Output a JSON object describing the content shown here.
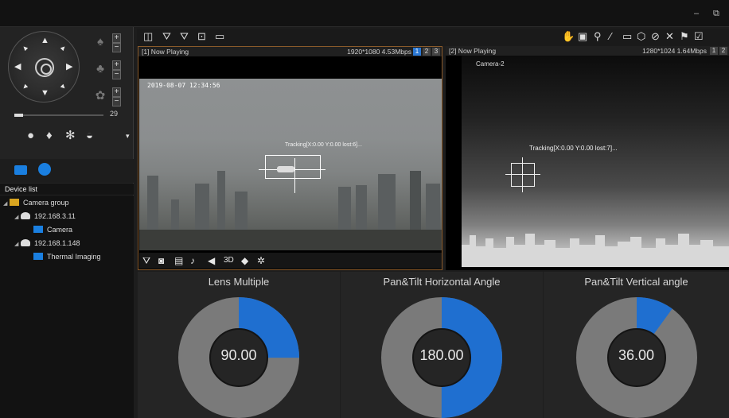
{
  "window": {
    "minimize_label": "–",
    "restore_label": "⧉"
  },
  "ptz": {
    "speed_value": "29",
    "speed_fraction": 0.1
  },
  "device_list": {
    "title": "Device list",
    "group_label": "Camera group",
    "devices": [
      {
        "ip": "192.168.3.11",
        "channel": "Camera"
      },
      {
        "ip": "192.168.1.148",
        "channel": "Thermal Imaging"
      }
    ]
  },
  "video1": {
    "title": "[1] Now Playing",
    "stats": "1920*1080 4.53Mbps",
    "pages": [
      "1",
      "2",
      "3"
    ],
    "active_page": "1",
    "timestamp": "2019-08-07 12:34:56",
    "tracking_text": "Tracking[X:0.00 Y:0.00 lost:6]...",
    "toolbar_3d": "3D"
  },
  "video2": {
    "title": "[2] Now Playing",
    "stats": "1280*1024 1.64Mbps",
    "pages": [
      "1",
      "2"
    ],
    "camera_label": "Camera-2",
    "tracking_text": "Tracking[X:0.00 Y:0.00 lost:7]..."
  },
  "gauges": [
    {
      "title": "Lens Multiple",
      "value_text": "90.00",
      "fraction": 0.25
    },
    {
      "title": "Pan&Tilt Horizontal Angle",
      "value_text": "180.00",
      "fraction": 0.5
    },
    {
      "title": "Pan&Tilt Vertical angle",
      "value_text": "36.00",
      "fraction": 0.1
    }
  ],
  "colors": {
    "accent": "#1f6fd0",
    "gauge_bg": "#7a7a7a",
    "active_border": "#8a5a2a"
  },
  "icons": {
    "ptz_up": "▲",
    "ptz_down": "▼",
    "ptz_left": "◀",
    "ptz_right": "▶",
    "zoom": "focus-icon",
    "iris": "iris-icon",
    "focus": "aperture-icon",
    "light": "bulb-icon",
    "fire": "flame-icon",
    "fan": "fan-icon",
    "wiper": "wiper-icon"
  }
}
